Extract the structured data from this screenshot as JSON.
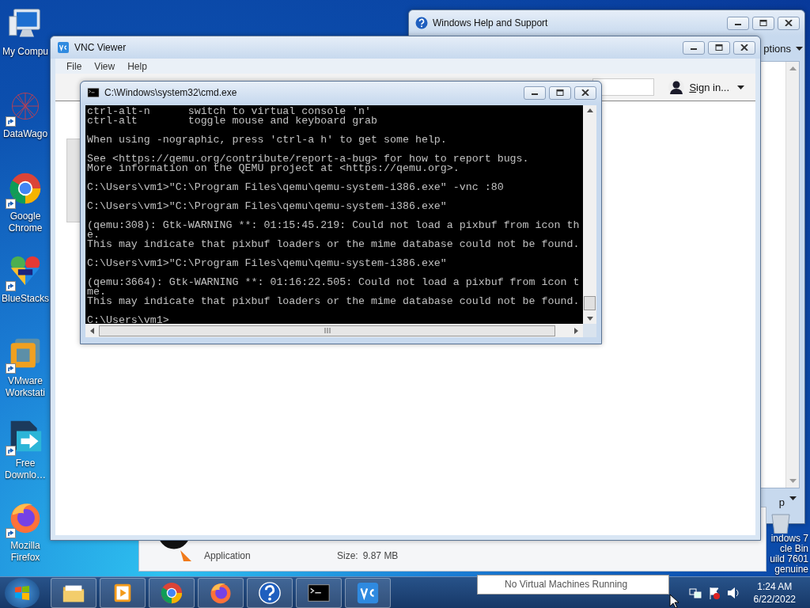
{
  "desktop_icons": [
    {
      "kind": "computer",
      "label": "My Compu",
      "shortcut": false
    },
    {
      "kind": "network",
      "label": "DataWago",
      "shortcut": true
    },
    {
      "kind": "chrome",
      "label": "Google Chrome",
      "shortcut": true
    },
    {
      "kind": "bluestacks",
      "label": "BlueStacks",
      "shortcut": true
    },
    {
      "kind": "vmware",
      "label": "VMware Workstati",
      "shortcut": true
    },
    {
      "kind": "download",
      "label": "Free Downlo…",
      "shortcut": true
    },
    {
      "kind": "firefox",
      "label": "Mozilla Firefox",
      "shortcut": true
    }
  ],
  "desktop_corner": {
    "recycle_bin_label": "cle Bin",
    "watermark": [
      "indows 7",
      "uild 7601",
      "genuine"
    ]
  },
  "help_window": {
    "title": "Windows Help and Support",
    "options_label": "ptions",
    "bottom_label": "p"
  },
  "download_panel": {
    "type": "Application",
    "size_label": "Size:",
    "size": "9.87 MB"
  },
  "vnc_window": {
    "title": "VNC Viewer",
    "menu": [
      "File",
      "View",
      "Help"
    ],
    "sign_in": "Sign in..."
  },
  "cmd_window": {
    "title": "C:\\Windows\\system32\\cmd.exe",
    "paragraphs": [
      [
        "ctrl-alt-n      switch to virtual console 'n'",
        "ctrl-alt        toggle mouse and keyboard grab"
      ],
      [
        "When using -nographic, press 'ctrl-a h' to get some help."
      ],
      [
        "See <https://qemu.org/contribute/report-a-bug> for how to report bugs.",
        "More information on the QEMU project at <https://qemu.org>."
      ],
      [
        "C:\\Users\\vm1>\"C:\\Program Files\\qemu\\qemu-system-i386.exe\" -vnc :80"
      ],
      [
        "C:\\Users\\vm1>\"C:\\Program Files\\qemu\\qemu-system-i386.exe\""
      ],
      [
        "(qemu:308): Gtk-WARNING **: 01:15:45.219: Could not load a pixbuf from icon th",
        "e.",
        "This may indicate that pixbuf loaders or the mime database could not be found."
      ],
      [
        "C:\\Users\\vm1>\"C:\\Program Files\\qemu\\qemu-system-i386.exe\""
      ],
      [
        "(qemu:3664): Gtk-WARNING **: 01:16:22.505: Could not load a pixbuf from icon t",
        "me.",
        "This may indicate that pixbuf loaders or the mime database could not be found."
      ],
      [
        "C:\\Users\\vm1>"
      ]
    ]
  },
  "taskbar": {
    "apps": [
      {
        "kind": "explorer"
      },
      {
        "kind": "media"
      },
      {
        "kind": "chrome"
      },
      {
        "kind": "firefox"
      },
      {
        "kind": "help"
      },
      {
        "kind": "cmd"
      },
      {
        "kind": "vnc"
      }
    ],
    "tooltip": "No Virtual Machines Running",
    "time": "1:24 AM",
    "date": "6/22/2022"
  }
}
